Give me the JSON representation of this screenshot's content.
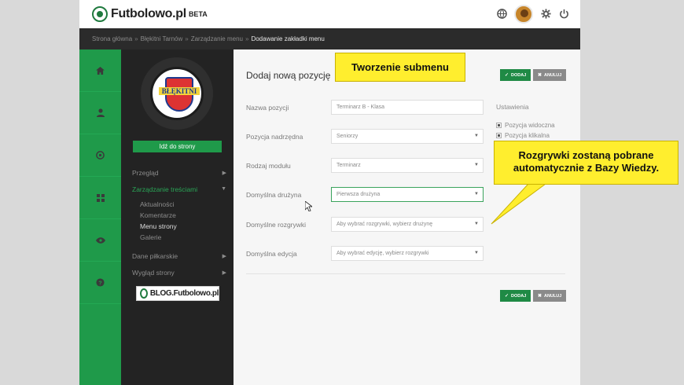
{
  "header": {
    "logo_text": "Futbolowo.pl",
    "logo_badge": "BETA",
    "icons": [
      "globe-icon",
      "avatar",
      "gear-icon",
      "power-icon"
    ]
  },
  "breadcrumb": {
    "items": [
      "Strona główna",
      "Błękitni Tarnów",
      "Zarządzanie menu"
    ],
    "current": "Dodawanie zakładki menu"
  },
  "rail": {
    "icons": [
      "home-icon",
      "user-icon",
      "soccer-ball-icon",
      "grid-icon",
      "eye-icon",
      "help-icon"
    ]
  },
  "sidebar": {
    "club_text": "BŁĘKITNI",
    "goto_button": "Idź do strony",
    "menu": [
      {
        "label": "Przegląd"
      },
      {
        "label": "Zarządzanie treściami"
      },
      {
        "label": "Dane piłkarskie"
      },
      {
        "label": "Wygląd strony"
      }
    ],
    "submenu": [
      "Aktualności",
      "Komentarze",
      "Menu strony",
      "Galerie"
    ],
    "blog_badge": "BLOG.Futbolowo.pl"
  },
  "content": {
    "title": "Dodaj nową pozycję",
    "save_label": "DODAJ",
    "cancel_label": "ANULUJ",
    "fields": [
      {
        "label": "Nazwa pozycji",
        "value": "Terminarz B - Klasa",
        "type": "text"
      },
      {
        "label": "Pozycja nadrzędna",
        "value": "Seniorzy",
        "type": "select"
      },
      {
        "label": "Rodzaj modułu",
        "value": "Terminarz",
        "type": "select"
      },
      {
        "label": "Domyślna drużyna",
        "value": "Pierwsza drużyna",
        "type": "select"
      },
      {
        "label": "Domyślne rozgrywki",
        "value": "Aby wybrać rozgrywki, wybierz drużynę",
        "type": "select"
      },
      {
        "label": "Domyślna edycja",
        "value": "Aby wybrać edycję, wybierz rozgrywki",
        "type": "select"
      }
    ],
    "settings": {
      "title": "Ustawienia",
      "options": [
        {
          "label": "Pozycja widoczna",
          "checked": true
        },
        {
          "label": "Pozycja klikalna",
          "checked": true
        }
      ]
    }
  },
  "callouts": {
    "title": "Tworzenie submenu",
    "note_line1": "Rozgrywki zostaną pobrane",
    "note_line2": "automatycznie z Bazy Wiedzy."
  },
  "colors": {
    "accent": "#1f9a4a",
    "dark": "#232323",
    "callout": "#ffee2e"
  }
}
